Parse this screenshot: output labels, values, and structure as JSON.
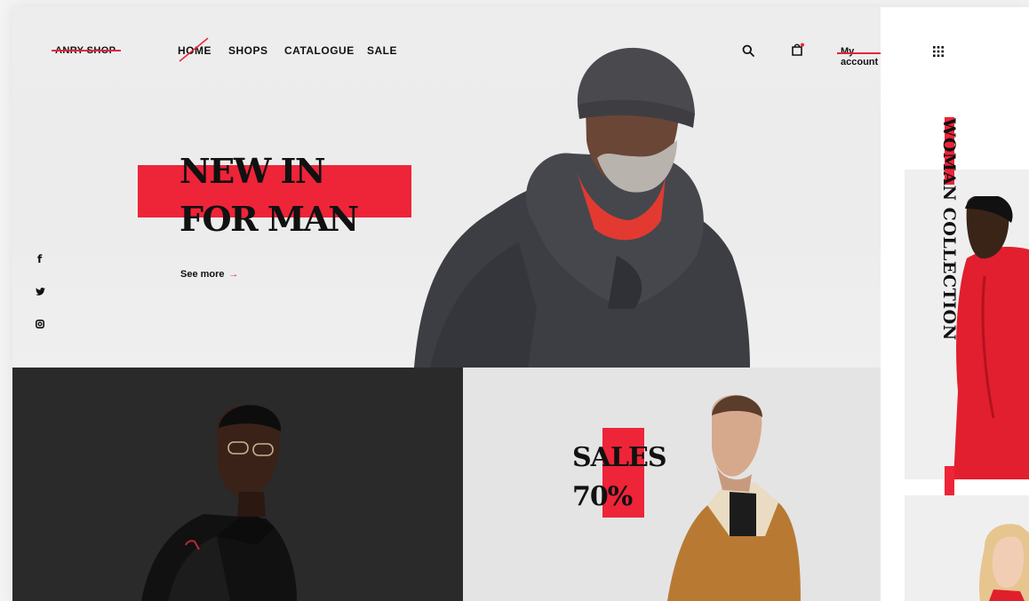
{
  "brand": {
    "logo_text": "ANRY SHOP"
  },
  "nav": {
    "items": [
      {
        "label": "HOME"
      },
      {
        "label": "SHOPS"
      },
      {
        "label": "CATALOGUE"
      },
      {
        "label": "SALE"
      }
    ],
    "account_label": "My account",
    "icons": [
      "search-icon",
      "cart-icon",
      "grid-menu-icon"
    ]
  },
  "hero": {
    "title_line1": "NEW IN",
    "title_line2": "FOR MAN",
    "cta_label": "See more",
    "cta_arrow": "→"
  },
  "social": {
    "facebook": "f",
    "icons": [
      "facebook-icon",
      "twitter-icon",
      "instagram-icon"
    ]
  },
  "sales_tile": {
    "line1": "SALES",
    "line2": "70%"
  },
  "side_panel": {
    "vertical_title": "WOMAN COLLECTION"
  },
  "colors": {
    "accent": "#ee2438",
    "dark_tile": "#2a2a2a",
    "light_bg": "#ececec"
  }
}
